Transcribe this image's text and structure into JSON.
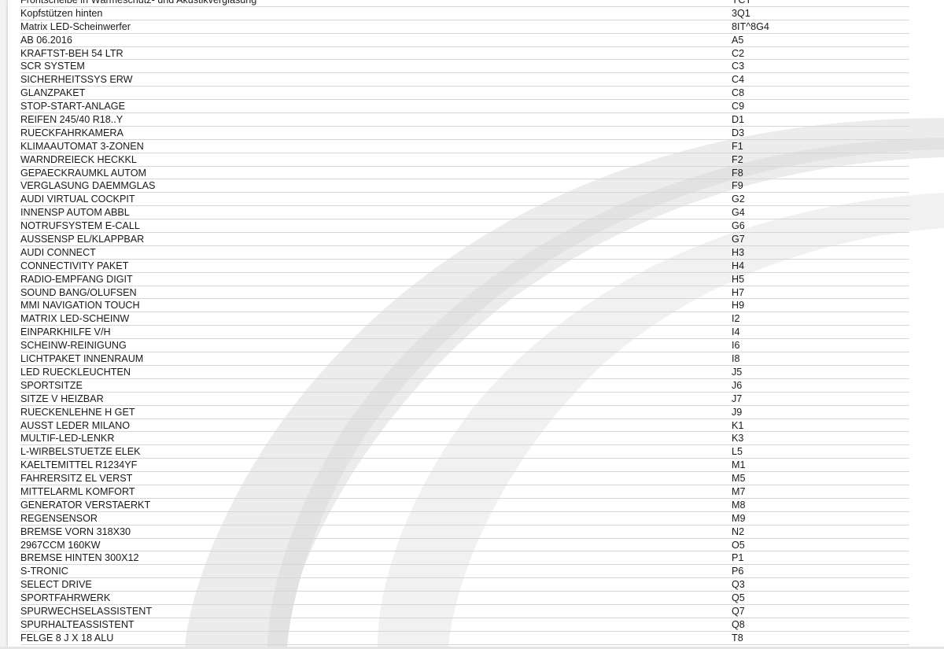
{
  "rows": [
    {
      "desc": "Frontscheibe in Wärmeschutz- und Akustikverglasung",
      "code": "YCT"
    },
    {
      "desc": "Kopfstützen hinten",
      "code": "3Q1"
    },
    {
      "desc": "Matrix LED-Scheinwerfer",
      "code": "8IT^8G4"
    },
    {
      "desc": "AB 06.2016",
      "code": "A5"
    },
    {
      "desc": "KRAFTST-BEH 54 LTR",
      "code": "C2"
    },
    {
      "desc": "SCR SYSTEM",
      "code": "C3"
    },
    {
      "desc": "SICHERHEITSSYS ERW",
      "code": "C4"
    },
    {
      "desc": "GLANZPAKET",
      "code": "C8"
    },
    {
      "desc": "STOP-START-ANLAGE",
      "code": "C9"
    },
    {
      "desc": "REIFEN 245/40 R18..Y",
      "code": "D1"
    },
    {
      "desc": "RUECKFAHRKAMERA",
      "code": "D3"
    },
    {
      "desc": "KLIMAAUTOMAT 3-ZONEN",
      "code": "F1"
    },
    {
      "desc": "WARNDREIECK HECKKL",
      "code": "F2"
    },
    {
      "desc": "GEPAECKRAUMKL AUTOM",
      "code": "F8"
    },
    {
      "desc": "VERGLASUNG DAEMMGLAS",
      "code": "F9"
    },
    {
      "desc": "AUDI VIRTUAL COCKPIT",
      "code": "G2"
    },
    {
      "desc": "INNENSP AUTOM ABBL",
      "code": "G4"
    },
    {
      "desc": "NOTRUFSYSTEM E-CALL",
      "code": "G6"
    },
    {
      "desc": "AUSSENSP EL/KLAPPBAR",
      "code": "G7"
    },
    {
      "desc": "AUDI CONNECT",
      "code": "H3"
    },
    {
      "desc": "CONNECTIVITY PAKET",
      "code": "H4"
    },
    {
      "desc": "RADIO-EMPFANG DIGIT",
      "code": "H5"
    },
    {
      "desc": "SOUND BANG/OLUFSEN",
      "code": "H7"
    },
    {
      "desc": "MMI NAVIGATION TOUCH",
      "code": "H9"
    },
    {
      "desc": "MATRIX LED-SCHEINW",
      "code": "I2"
    },
    {
      "desc": "EINPARKHILFE V/H",
      "code": "I4"
    },
    {
      "desc": "SCHEINW-REINIGUNG",
      "code": "I6"
    },
    {
      "desc": "LICHTPAKET INNENRAUM",
      "code": "I8"
    },
    {
      "desc": "LED RUECKLEUCHTEN",
      "code": "J5"
    },
    {
      "desc": "SPORTSITZE",
      "code": "J6"
    },
    {
      "desc": "SITZE V HEIZBAR",
      "code": "J7"
    },
    {
      "desc": "RUECKENLEHNE H GET",
      "code": "J9"
    },
    {
      "desc": "AUSST LEDER MILANO",
      "code": "K1"
    },
    {
      "desc": "MULTIF-LED-LENKR",
      "code": "K3"
    },
    {
      "desc": "L-WIRBELSTUETZE ELEK",
      "code": "L5"
    },
    {
      "desc": "KAELTEMITTEL R1234YF",
      "code": "M1"
    },
    {
      "desc": "FAHRERSITZ EL VERST",
      "code": "M5"
    },
    {
      "desc": "MITTELARML KOMFORT",
      "code": "M7"
    },
    {
      "desc": "GENERATOR VERSTAERKT",
      "code": "M8"
    },
    {
      "desc": "REGENSENSOR",
      "code": "M9"
    },
    {
      "desc": "BREMSE VORN 318X30",
      "code": "N2"
    },
    {
      "desc": "2967CCM 160KW",
      "code": "O5"
    },
    {
      "desc": "BREMSE HINTEN 300X12",
      "code": "P1"
    },
    {
      "desc": "S-TRONIC",
      "code": "P6"
    },
    {
      "desc": "SELECT DRIVE",
      "code": "Q3"
    },
    {
      "desc": "SPORTFAHRWERK",
      "code": "Q5"
    },
    {
      "desc": "SPURWECHSELASSISTENT",
      "code": "Q7"
    },
    {
      "desc": "SPURHALTEASSISTENT",
      "code": "Q8"
    },
    {
      "desc": "FELGE 8 J X 18 ALU",
      "code": "T8"
    }
  ]
}
